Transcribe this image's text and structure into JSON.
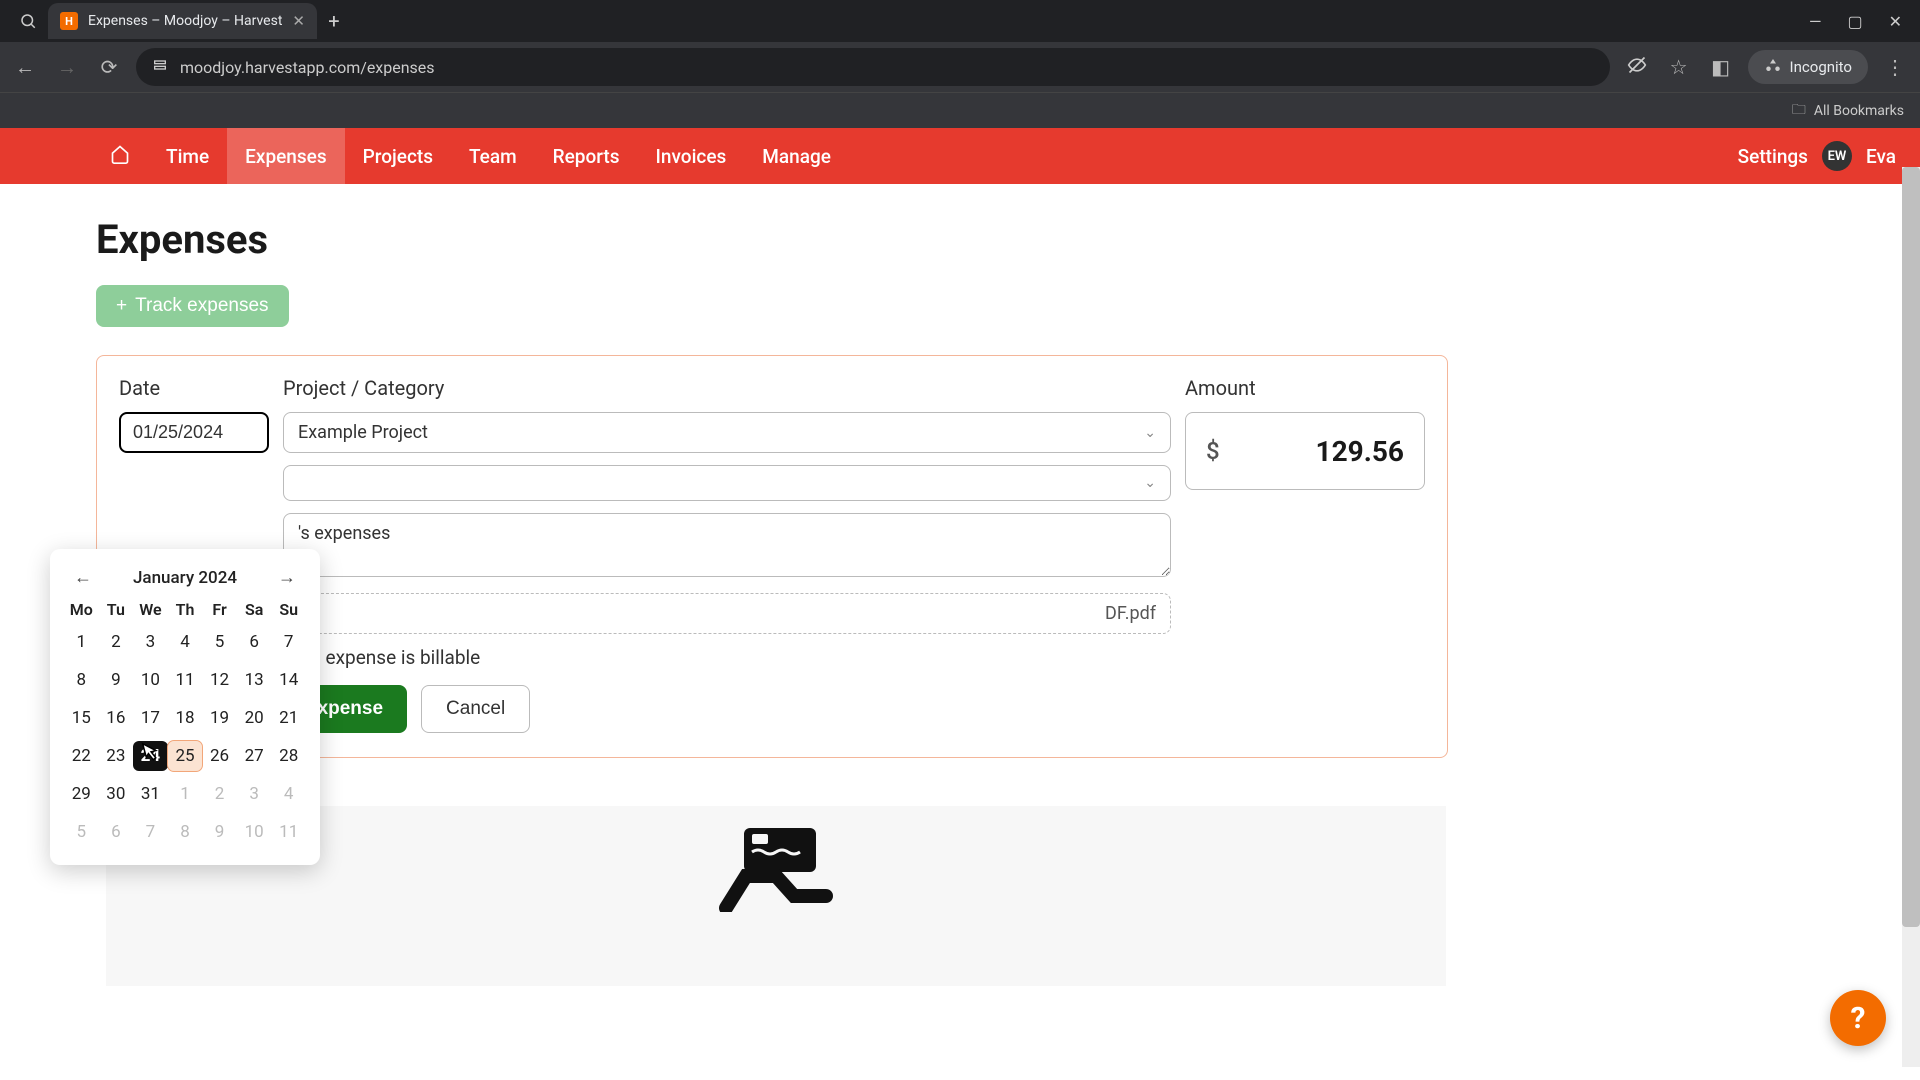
{
  "browser": {
    "tab_title": "Expenses – Moodjoy – Harvest",
    "favicon_letter": "H",
    "url": "moodjoy.harvestapp.com/expenses",
    "incognito_label": "Incognito",
    "all_bookmarks": "All Bookmarks"
  },
  "nav": {
    "items": [
      "Time",
      "Expenses",
      "Projects",
      "Team",
      "Reports",
      "Invoices",
      "Manage"
    ],
    "active_index": 1,
    "settings": "Settings",
    "user_initials": "EW",
    "user_name": "Eva"
  },
  "page": {
    "title": "Expenses",
    "track_btn": "Track expenses"
  },
  "form": {
    "date_label": "Date",
    "date_value": "01/25/2024",
    "project_label": "Project / Category",
    "project_value": "Example Project",
    "category_value": "",
    "notes_value": "'s expenses",
    "file_name": "DF.pdf",
    "billable_label": "s expense is billable",
    "amount_label": "Amount",
    "amount_currency": "$",
    "amount_value": "129.56",
    "save_btn": "expense",
    "cancel_btn": "Cancel"
  },
  "calendar": {
    "title": "January 2024",
    "dow": [
      "Mo",
      "Tu",
      "We",
      "Th",
      "Fr",
      "Sa",
      "Su"
    ],
    "weeks": [
      [
        {
          "d": 1
        },
        {
          "d": 2
        },
        {
          "d": 3
        },
        {
          "d": 4
        },
        {
          "d": 5
        },
        {
          "d": 6
        },
        {
          "d": 7
        }
      ],
      [
        {
          "d": 8
        },
        {
          "d": 9
        },
        {
          "d": 10
        },
        {
          "d": 11
        },
        {
          "d": 12
        },
        {
          "d": 13
        },
        {
          "d": 14
        }
      ],
      [
        {
          "d": 15
        },
        {
          "d": 16
        },
        {
          "d": 17
        },
        {
          "d": 18
        },
        {
          "d": 19
        },
        {
          "d": 20
        },
        {
          "d": 21
        }
      ],
      [
        {
          "d": 22
        },
        {
          "d": 23
        },
        {
          "d": 24,
          "today": true
        },
        {
          "d": 25,
          "sel": true
        },
        {
          "d": 26
        },
        {
          "d": 27
        },
        {
          "d": 28
        }
      ],
      [
        {
          "d": 29
        },
        {
          "d": 30
        },
        {
          "d": 31
        },
        {
          "d": 1,
          "out": true
        },
        {
          "d": 2,
          "out": true
        },
        {
          "d": 3,
          "out": true
        },
        {
          "d": 4,
          "out": true
        }
      ],
      [
        {
          "d": 5,
          "out": true
        },
        {
          "d": 6,
          "out": true
        },
        {
          "d": 7,
          "out": true
        },
        {
          "d": 8,
          "out": true
        },
        {
          "d": 9,
          "out": true
        },
        {
          "d": 10,
          "out": true
        },
        {
          "d": 11,
          "out": true
        }
      ]
    ]
  },
  "help": "?"
}
